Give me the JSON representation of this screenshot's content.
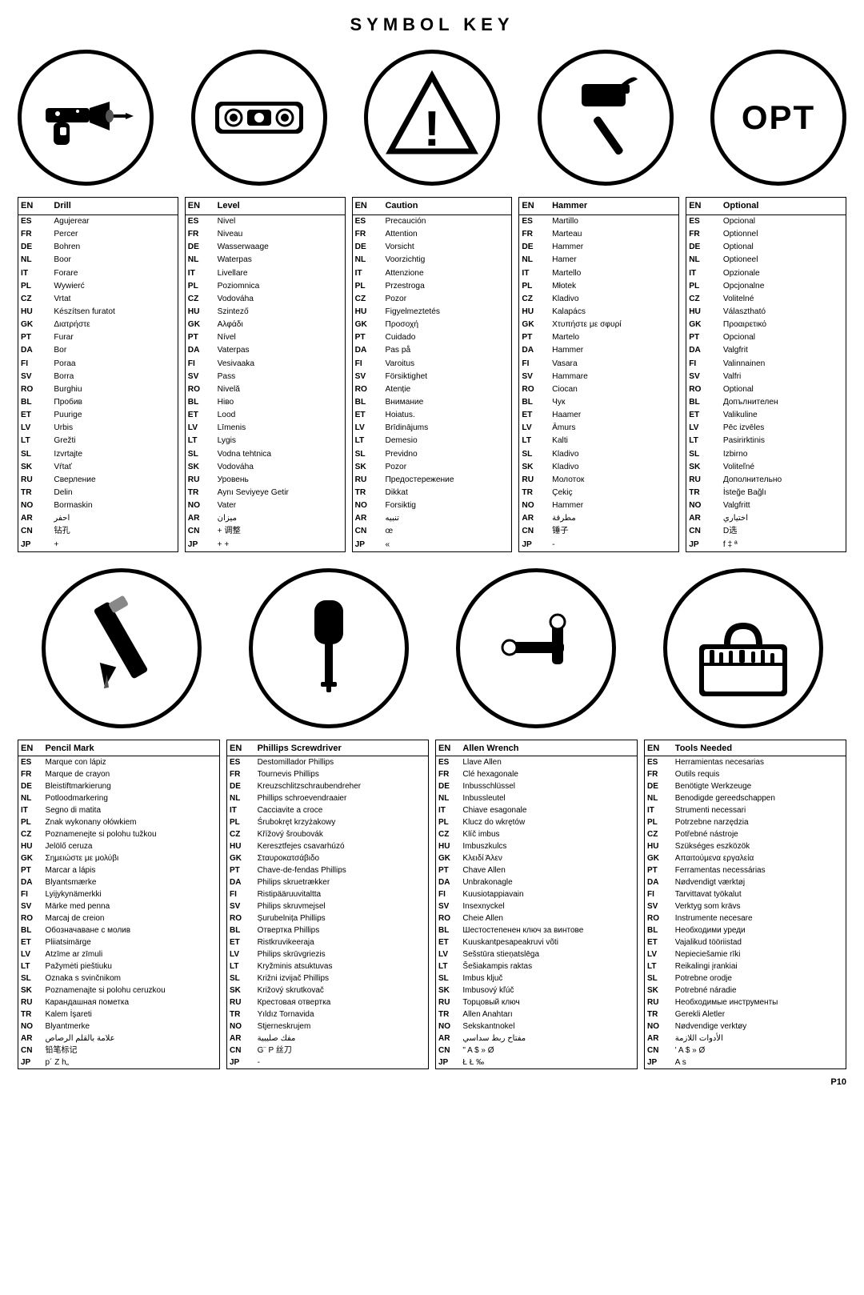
{
  "title": "SYMBOL KEY",
  "icons_row1": [
    {
      "name": "drill",
      "type": "drill"
    },
    {
      "name": "level",
      "type": "level"
    },
    {
      "name": "caution",
      "type": "caution"
    },
    {
      "name": "hammer",
      "type": "hammer"
    },
    {
      "name": "optional",
      "type": "opt",
      "text": "OPT"
    }
  ],
  "tables_row1": [
    {
      "header": [
        "EN",
        "Drill"
      ],
      "rows": [
        [
          "ES",
          "Agujerear"
        ],
        [
          "FR",
          "Percer"
        ],
        [
          "DE",
          "Bohren"
        ],
        [
          "NL",
          "Boor"
        ],
        [
          "IT",
          "Forare"
        ],
        [
          "PL",
          "Wywierć"
        ],
        [
          "CZ",
          "Vrtat"
        ],
        [
          "HU",
          "Készítsen furatot"
        ],
        [
          "GK",
          "Διατρήστε"
        ],
        [
          "PT",
          "Furar"
        ],
        [
          "DA",
          "Bor"
        ],
        [
          "FI",
          "Poraa"
        ],
        [
          "SV",
          "Borra"
        ],
        [
          "RO",
          "Burghiu"
        ],
        [
          "BL",
          "Пробив"
        ],
        [
          "ET",
          "Puurige"
        ],
        [
          "LV",
          "Urbis"
        ],
        [
          "LT",
          "Grežti"
        ],
        [
          "SL",
          "Izvrtajte"
        ],
        [
          "SK",
          "Vŕtať"
        ],
        [
          "RU",
          "Сверление"
        ],
        [
          "TR",
          "Delin"
        ],
        [
          "NO",
          "Bormaskin"
        ],
        [
          "AR",
          "احفر"
        ],
        [
          "CN",
          "钻孔"
        ],
        [
          "JP",
          "+"
        ]
      ]
    },
    {
      "header": [
        "EN",
        "Level"
      ],
      "rows": [
        [
          "ES",
          "Nivel"
        ],
        [
          "FR",
          "Niveau"
        ],
        [
          "DE",
          "Wasserwaage"
        ],
        [
          "NL",
          "Waterpas"
        ],
        [
          "IT",
          "Livellare"
        ],
        [
          "PL",
          "Poziomnica"
        ],
        [
          "CZ",
          "Vodováha"
        ],
        [
          "HU",
          "Szintező"
        ],
        [
          "GK",
          "Αλφάδι"
        ],
        [
          "PT",
          "Nível"
        ],
        [
          "DA",
          "Vaterpas"
        ],
        [
          "FI",
          "Vesivaaka"
        ],
        [
          "SV",
          "Pass"
        ],
        [
          "RO",
          "Nivelă"
        ],
        [
          "BL",
          "Нiво"
        ],
        [
          "ET",
          "Lood"
        ],
        [
          "LV",
          "Līmenis"
        ],
        [
          "LT",
          "Lygis"
        ],
        [
          "SL",
          "Vodna tehtnica"
        ],
        [
          "SK",
          "Vodováha"
        ],
        [
          "RU",
          "Уровень"
        ],
        [
          "TR",
          "Aynı Seviyeye Getir"
        ],
        [
          "NO",
          "Vater"
        ],
        [
          "AR",
          "ميزان"
        ],
        [
          "CN",
          "+ 调整"
        ],
        [
          "JP",
          "+ +"
        ]
      ]
    },
    {
      "header": [
        "EN",
        "Caution"
      ],
      "rows": [
        [
          "ES",
          "Precaución"
        ],
        [
          "FR",
          "Attention"
        ],
        [
          "DE",
          "Vorsicht"
        ],
        [
          "NL",
          "Voorzichtig"
        ],
        [
          "IT",
          "Attenzione"
        ],
        [
          "PL",
          "Przestroga"
        ],
        [
          "CZ",
          "Pozor"
        ],
        [
          "HU",
          "Figyelmeztetés"
        ],
        [
          "GK",
          "Προσοχή"
        ],
        [
          "PT",
          "Cuidado"
        ],
        [
          "DA",
          "Pas på"
        ],
        [
          "FI",
          "Varoitus"
        ],
        [
          "SV",
          "Försiktighet"
        ],
        [
          "RO",
          "Atenție"
        ],
        [
          "BL",
          "Внимание"
        ],
        [
          "ET",
          "Hoiatus."
        ],
        [
          "LV",
          "Brīdinājums"
        ],
        [
          "LT",
          "Demesio"
        ],
        [
          "SL",
          "Previdno"
        ],
        [
          "SK",
          "Pozor"
        ],
        [
          "RU",
          "Предостережение"
        ],
        [
          "TR",
          "Dikkat"
        ],
        [
          "NO",
          "Forsiktig"
        ],
        [
          "AR",
          "تنبيه"
        ],
        [
          "CN",
          "œ"
        ],
        [
          "JP",
          "«"
        ]
      ]
    },
    {
      "header": [
        "EN",
        "Hammer"
      ],
      "rows": [
        [
          "ES",
          "Martillo"
        ],
        [
          "FR",
          "Marteau"
        ],
        [
          "DE",
          "Hammer"
        ],
        [
          "NL",
          "Hamer"
        ],
        [
          "IT",
          "Martello"
        ],
        [
          "PL",
          "Młotek"
        ],
        [
          "CZ",
          "Kladivo"
        ],
        [
          "HU",
          "Kalapács"
        ],
        [
          "GK",
          "Χτυπήστε με σφυρί"
        ],
        [
          "PT",
          "Martelo"
        ],
        [
          "DA",
          "Hammer"
        ],
        [
          "FI",
          "Vasara"
        ],
        [
          "SV",
          "Hammare"
        ],
        [
          "RO",
          "Ciocan"
        ],
        [
          "BL",
          "Чук"
        ],
        [
          "ET",
          "Haamer"
        ],
        [
          "LV",
          "Āmurs"
        ],
        [
          "LT",
          "Kalti"
        ],
        [
          "SL",
          "Kladivo"
        ],
        [
          "SK",
          "Kladivo"
        ],
        [
          "RU",
          "Молоток"
        ],
        [
          "TR",
          "Çekiç"
        ],
        [
          "NO",
          "Hammer"
        ],
        [
          "AR",
          "مطرقة"
        ],
        [
          "CN",
          "锤子"
        ],
        [
          "JP",
          "-"
        ]
      ]
    },
    {
      "header": [
        "EN",
        "Optional"
      ],
      "rows": [
        [
          "ES",
          "Opcional"
        ],
        [
          "FR",
          "Optionnel"
        ],
        [
          "DE",
          "Optional"
        ],
        [
          "NL",
          "Optioneel"
        ],
        [
          "IT",
          "Opzionale"
        ],
        [
          "PL",
          "Opcjonalne"
        ],
        [
          "CZ",
          "Volitelné"
        ],
        [
          "HU",
          "Választható"
        ],
        [
          "GK",
          "Προαιρετικό"
        ],
        [
          "PT",
          "Opcional"
        ],
        [
          "DA",
          "Valgfrit"
        ],
        [
          "FI",
          "Valinnainen"
        ],
        [
          "SV",
          "Valfri"
        ],
        [
          "RO",
          "Optional"
        ],
        [
          "BL",
          "Дoпълнителен"
        ],
        [
          "ET",
          "Valikuline"
        ],
        [
          "LV",
          "Pēc izvēles"
        ],
        [
          "LT",
          "Pasirirktinis"
        ],
        [
          "SL",
          "Izbirno"
        ],
        [
          "SK",
          "Voliteľné"
        ],
        [
          "RU",
          "Дополнительно"
        ],
        [
          "TR",
          "İsteğe Bağlı"
        ],
        [
          "NO",
          "Valgfritt"
        ],
        [
          "AR",
          "اختياري"
        ],
        [
          "CN",
          "D选"
        ],
        [
          "JP",
          "f ‡ ª"
        ]
      ]
    }
  ],
  "icons_row2": [
    {
      "name": "pencil",
      "type": "pencil"
    },
    {
      "name": "phillips",
      "type": "phillips"
    },
    {
      "name": "allen",
      "type": "allen"
    },
    {
      "name": "toolbox",
      "type": "toolbox"
    }
  ],
  "tables_row2": [
    {
      "header": [
        "EN",
        "Pencil Mark"
      ],
      "rows": [
        [
          "ES",
          "Marque con lápiz"
        ],
        [
          "FR",
          "Marque de crayon"
        ],
        [
          "DE",
          "Bleistiftmarkierung"
        ],
        [
          "NL",
          "Potloodmarkering"
        ],
        [
          "IT",
          "Segno di matita"
        ],
        [
          "PL",
          "Znak wykonany ołówkiem"
        ],
        [
          "CZ",
          "Poznamenejte si polohu tužkou"
        ],
        [
          "HU",
          "Jelölő ceruza"
        ],
        [
          "GK",
          "Σημειώστε με μολύβι"
        ],
        [
          "PT",
          "Marcar a lápis"
        ],
        [
          "DA",
          "Blyantsmærke"
        ],
        [
          "FI",
          "Lyijykynämerkki"
        ],
        [
          "SV",
          "Märke med penna"
        ],
        [
          "RO",
          "Marcaj de creion"
        ],
        [
          "BL",
          "Обозначаване с молив"
        ],
        [
          "ET",
          "Pliiatsimärge"
        ],
        [
          "LV",
          "Atzīme ar zīmuli"
        ],
        [
          "LT",
          "Pažymėti pieštiuku"
        ],
        [
          "SL",
          "Oznaka s svinčnikom"
        ],
        [
          "SK",
          "Poznamenajte si polohu ceruzkou"
        ],
        [
          "RU",
          "Карандашная пометка"
        ],
        [
          "TR",
          "Kalem İşareti"
        ],
        [
          "NO",
          "Blyantmerke"
        ],
        [
          "AR",
          "علامة بالقلم الرصاص"
        ],
        [
          "CN",
          "铅笔标记"
        ],
        [
          "JP",
          "p´ Z h„"
        ]
      ]
    },
    {
      "header": [
        "EN",
        "Phillips Screwdriver"
      ],
      "rows": [
        [
          "ES",
          "Destomillador Phillips"
        ],
        [
          "FR",
          "Tournevis Phillips"
        ],
        [
          "DE",
          "Kreuzschlitzschraubendreher"
        ],
        [
          "NL",
          "Phillips schroevendraaier"
        ],
        [
          "IT",
          "Cacciavite a croce"
        ],
        [
          "PL",
          "Śrubokręt krzyżakowy"
        ],
        [
          "CZ",
          "Křížový šroubovák"
        ],
        [
          "HU",
          "Keresztfejes csavarhúzó"
        ],
        [
          "GK",
          "Σταυροκατσάβιδο"
        ],
        [
          "PT",
          "Chave-de-fendas Phillips"
        ],
        [
          "DA",
          "Philips skruetrækker"
        ],
        [
          "FI",
          "Ristipääruuvitaltta"
        ],
        [
          "SV",
          "Philips skruvmejsel"
        ],
        [
          "RO",
          "Șurubelnița Phillips"
        ],
        [
          "BL",
          "Отвертка Phillips"
        ],
        [
          "ET",
          "Ristkruvikeeraja"
        ],
        [
          "LV",
          "Philips skrūvgriezis"
        ],
        [
          "LT",
          "Kryžminis atsuktuvas"
        ],
        [
          "SL",
          "Križni izvijač Phillips"
        ],
        [
          "SK",
          "Križový skrutkovač"
        ],
        [
          "RU",
          "Крестовая отвертка"
        ],
        [
          "TR",
          "Yıldız Tornavida"
        ],
        [
          "NO",
          "Stjerneskrujem"
        ],
        [
          "AR",
          "مفك صليبية"
        ],
        [
          "CN",
          "G¨ P 丝刀"
        ],
        [
          "JP",
          "-"
        ]
      ]
    },
    {
      "header": [
        "EN",
        "Allen Wrench"
      ],
      "rows": [
        [
          "ES",
          "Llave Allen"
        ],
        [
          "FR",
          "Clé hexagonale"
        ],
        [
          "DE",
          "Inbusschlüssel"
        ],
        [
          "NL",
          "Inbussleutel"
        ],
        [
          "IT",
          "Chiave esagonale"
        ],
        [
          "PL",
          "Klucz do wkrętów"
        ],
        [
          "CZ",
          "Klíč imbus"
        ],
        [
          "HU",
          "Imbuszkulcs"
        ],
        [
          "GK",
          "Κλειδί Άλεν"
        ],
        [
          "PT",
          "Chave Allen"
        ],
        [
          "DA",
          "Unbrakonagle"
        ],
        [
          "FI",
          "Kuusiotappiavain"
        ],
        [
          "SV",
          "Insexnyckel"
        ],
        [
          "RO",
          "Cheie Allen"
        ],
        [
          "BL",
          "Шестостепенен ключ за винтове"
        ],
        [
          "ET",
          "Kuuskantpesapeakruvi võti"
        ],
        [
          "LV",
          "Sešstūra stieņatslēga"
        ],
        [
          "LT",
          "Šešiakampis raktas"
        ],
        [
          "SL",
          "Imbus ključ"
        ],
        [
          "SK",
          "Imbusový kľúč"
        ],
        [
          "RU",
          "Торцовый ключ"
        ],
        [
          "TR",
          "Allen Anahtarı"
        ],
        [
          "NO",
          "Sekskantnokel"
        ],
        [
          "AR",
          "مفتاح ربط سداسي"
        ],
        [
          "CN",
          "\" A $ » Ø"
        ],
        [
          "JP",
          "Ł Ł ‰"
        ]
      ]
    },
    {
      "header": [
        "EN",
        "Tools Needed"
      ],
      "rows": [
        [
          "ES",
          "Herramientas necesarias"
        ],
        [
          "FR",
          "Outils requis"
        ],
        [
          "DE",
          "Benötigte Werkzeuge"
        ],
        [
          "NL",
          "Benodigde gereedschappen"
        ],
        [
          "IT",
          "Strumenti necessari"
        ],
        [
          "PL",
          "Potrzebne narzędzia"
        ],
        [
          "CZ",
          "Potřebné nástroje"
        ],
        [
          "HU",
          "Szükséges eszközök"
        ],
        [
          "GK",
          "Απαιτούμενα εργαλεία"
        ],
        [
          "PT",
          "Ferramentas necessárias"
        ],
        [
          "DA",
          "Nødvendigt værktøj"
        ],
        [
          "FI",
          "Tarvittavat työkalut"
        ],
        [
          "SV",
          "Verktyg som krävs"
        ],
        [
          "RO",
          "Instrumente necesare"
        ],
        [
          "BL",
          "Необходими уреди"
        ],
        [
          "ET",
          "Vajalikud tööriistad"
        ],
        [
          "LV",
          "Nepieciešamie rīki"
        ],
        [
          "LT",
          "Reikalingi įrankiai"
        ],
        [
          "SL",
          "Potrebne orodje"
        ],
        [
          "SK",
          "Potrebné náradie"
        ],
        [
          "RU",
          "Необходимые инструменты"
        ],
        [
          "TR",
          "Gerekli Aletler"
        ],
        [
          "NO",
          "Nødvendige verktøy"
        ],
        [
          "AR",
          "الأدوات اللازمة"
        ],
        [
          "CN",
          "' A $ » Ø"
        ],
        [
          "JP",
          "A s"
        ]
      ]
    }
  ],
  "page_number": "P10"
}
